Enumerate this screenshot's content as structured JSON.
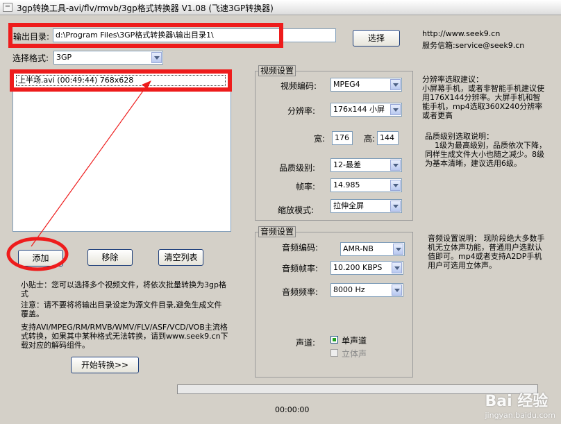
{
  "window": {
    "title": "3gp转换工具-avi/flv/rmvb/3gp格式转换器 V1.08 (飞速3GP转换器)"
  },
  "output": {
    "label": "输出目录:",
    "value": "d:\\Program Files\\3GP格式转换器\\输出目录1\\",
    "browse_button": "选择"
  },
  "format": {
    "label": "选择格式:",
    "selected": "3GP"
  },
  "contact": {
    "url": "http://www.seek9.cn",
    "email": "服务信箱:service@seek9.cn"
  },
  "file_list": {
    "items": [
      "上半场.avi (00:49:44) 768x628"
    ]
  },
  "buttons": {
    "add": "添加",
    "remove": "移除",
    "clear": "清空列表",
    "start": "开始转换>>"
  },
  "tips": {
    "tip1": "小贴士：您可以选择多个视频文件，将依次批量转换为3gp格式",
    "tip2": "注意：请不要将将输出目录设定为源文件目录,避免生成文件覆盖。",
    "tip3": "支持AVI/MPEG/RM/RMVB/WMV/FLV/ASF/VCD/VOB主流格式转换，如果其中某种格式无法转换，请到www.seek9.cn下载对应的解码组件。"
  },
  "video": {
    "group_title": "视频设置",
    "codec_label": "视频编码:",
    "codec": "MPEG4",
    "resolution_label": "分辨率:",
    "resolution": "176x144 小屏",
    "width_label": "宽:",
    "width": "176",
    "height_label": "高:",
    "height": "144",
    "quality_label": "品质级别:",
    "quality": "12-最差",
    "fps_label": "帧率:",
    "fps": "14.985",
    "zoom_label": "缩放模式:",
    "zoom": "拉伸全屏"
  },
  "audio": {
    "group_title": "音频设置",
    "codec_label": "音频编码:",
    "codec": "AMR-NB",
    "bitrate_label": "音频帧率:",
    "bitrate": "10.200 KBPS",
    "samplerate_label": "音频频率:",
    "samplerate": "8000 Hz",
    "channel_label": "声道:",
    "mono": "单声道",
    "stereo": "立体声"
  },
  "help": {
    "resolution": "分辨率选取建议：\n小屏幕手机，或者非智能手机建议使用176X144分辨率。大屏手机和智能手机，mp4选取360X240分辨率或者更高",
    "quality": "品质级别选取说明：\n    1级为最高级别，品质依次下降，同样生成文件大小也随之减少。8级为基本清晰，建议选用6级。",
    "audio": "音频设置说明：    现阶段绝大多数手机无立体声功能，普通用户选默认值即可。mp4或者支持A2DP手机用户可选用立体声。"
  },
  "status": {
    "time": "00:00:00",
    "progress": 0
  },
  "watermark": {
    "main": "Bai 经验",
    "sub": "jingyan.baidu.com"
  },
  "colors": {
    "annotation_red": "#ee1c1c",
    "window_bg": "#d4d0c8"
  }
}
